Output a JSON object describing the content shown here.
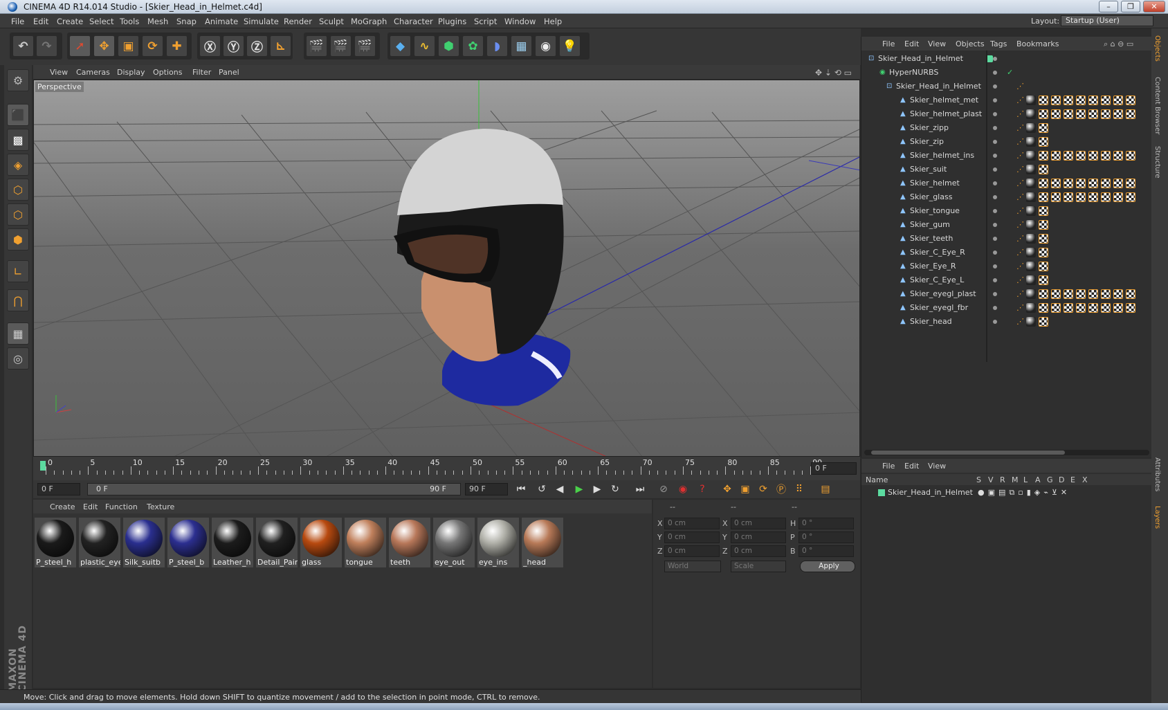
{
  "window": {
    "title": "CINEMA 4D R14.014 Studio - [Skier_Head_in_Helmet.c4d]",
    "minimize": "–",
    "restore": "❐",
    "close": "✕"
  },
  "menu": [
    "File",
    "Edit",
    "Create",
    "Select",
    "Tools",
    "Mesh",
    "Snap",
    "Animate",
    "Simulate",
    "Render",
    "Sculpt",
    "MoGraph",
    "Character",
    "Plugins",
    "Script",
    "Window",
    "Help"
  ],
  "layout": {
    "label": "Layout:",
    "value": "Startup (User)"
  },
  "viewport": {
    "menu": [
      "View",
      "Cameras",
      "Display",
      "Options",
      "Filter",
      "Panel"
    ],
    "label": "Perspective"
  },
  "timeline": {
    "ticks": [
      "0",
      "5",
      "10",
      "15",
      "20",
      "25",
      "30",
      "35",
      "40",
      "45",
      "50",
      "55",
      "60",
      "65",
      "70",
      "75",
      "80",
      "85",
      "90"
    ],
    "current_frame": "0 F",
    "start": "0 F",
    "range_start": "0 F",
    "range_end": "90 F",
    "end": "90 F"
  },
  "materials": {
    "menu": [
      "Create",
      "Edit",
      "Function",
      "Texture"
    ],
    "items": [
      {
        "name": "P_steel_h",
        "color": "#1a1a1a"
      },
      {
        "name": "plastic_eye",
        "color": "#222222"
      },
      {
        "name": "Silk_suitb",
        "color": "#2a2f8f"
      },
      {
        "name": "P_steel_b",
        "color": "#2c2f90"
      },
      {
        "name": "Leather_h",
        "color": "#1c1c1c"
      },
      {
        "name": "Detail_Pain",
        "color": "#202020"
      },
      {
        "name": "glass",
        "color": "#b84a10"
      },
      {
        "name": "tongue",
        "color": "#c0805c"
      },
      {
        "name": "teeth",
        "color": "#b8785a"
      },
      {
        "name": "eye_out",
        "color": "#777777"
      },
      {
        "name": "eye_ins",
        "color": "#b0b0a8"
      },
      {
        "name": "_head",
        "color": "#b87a58"
      }
    ]
  },
  "coords": {
    "headers": [
      "--",
      "--",
      "--"
    ],
    "rows": [
      {
        "a": "X",
        "av": "0 cm",
        "b": "X",
        "bv": "0 cm",
        "c": "H",
        "cv": "0 °"
      },
      {
        "a": "Y",
        "av": "0 cm",
        "b": "Y",
        "bv": "0 cm",
        "c": "P",
        "cv": "0 °"
      },
      {
        "a": "Z",
        "av": "0 cm",
        "b": "Z",
        "bv": "0 cm",
        "c": "B",
        "cv": "0 °"
      }
    ],
    "world": "World",
    "scale": "Scale",
    "apply": "Apply"
  },
  "status": "Move: Click and drag to move elements. Hold down SHIFT to quantize movement / add to the selection in point mode, CTRL to remove.",
  "objects": {
    "menu": [
      "File",
      "Edit",
      "View",
      "Objects",
      "Tags",
      "Bookmarks"
    ],
    "items": [
      {
        "name": "Skier_Head_in_Helmet",
        "level": 0,
        "tags": 0
      },
      {
        "name": "HyperNURBS",
        "level": 1,
        "tags": 0
      },
      {
        "name": "Skier_Head_in_Helmet",
        "level": 2,
        "tags": 0
      },
      {
        "name": "Skier_helmet_met",
        "level": 3,
        "tags": 8
      },
      {
        "name": "Skier_helmet_plast",
        "level": 3,
        "tags": 8
      },
      {
        "name": "Skier_zipp",
        "level": 3,
        "tags": 1
      },
      {
        "name": "Skier_zip",
        "level": 3,
        "tags": 1
      },
      {
        "name": "Skier_helmet_ins",
        "level": 3,
        "tags": 8
      },
      {
        "name": "Skier_suit",
        "level": 3,
        "tags": 1
      },
      {
        "name": "Skier_helmet",
        "level": 3,
        "tags": 8
      },
      {
        "name": "Skier_glass",
        "level": 3,
        "tags": 8
      },
      {
        "name": "Skier_tongue",
        "level": 3,
        "tags": 1
      },
      {
        "name": "Skier_gum",
        "level": 3,
        "tags": 1
      },
      {
        "name": "Skier_teeth",
        "level": 3,
        "tags": 1
      },
      {
        "name": "Skier_C_Eye_R",
        "level": 3,
        "tags": 1
      },
      {
        "name": "Skier_Eye_R",
        "level": 3,
        "tags": 1
      },
      {
        "name": "Skier_C_Eye_L",
        "level": 3,
        "tags": 1
      },
      {
        "name": "Skier_eyegl_plast",
        "level": 3,
        "tags": 8
      },
      {
        "name": "Skier_eyegl_fbr",
        "level": 3,
        "tags": 8
      },
      {
        "name": "Skier_head",
        "level": 3,
        "tags": 1
      }
    ]
  },
  "layers": {
    "menu": [
      "File",
      "Edit",
      "View"
    ],
    "columns": [
      "Name",
      "S",
      "V",
      "R",
      "M",
      "L",
      "A",
      "G",
      "D",
      "E",
      "X"
    ],
    "row": "Skier_Head_in_Helmet"
  },
  "sidetabs": [
    "Objects",
    "Content Browser",
    "Structure",
    "Attributes",
    "Layers"
  ],
  "colors": {
    "accent": "#f0a030",
    "select": "#5cdba0"
  }
}
